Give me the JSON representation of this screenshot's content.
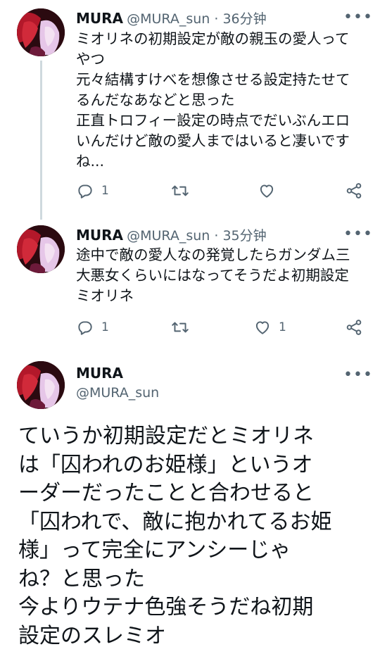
{
  "tweets": [
    {
      "name": "MURA",
      "handle": "@MURA_sun",
      "time": "36分钟",
      "text": "ミオリネの初期設定が敵の親玉の愛人って\nやつ\n元々結構すけべを想像させる設定持たせて\nるんだなあなどと思った\n正直トロフィー設定の時点でだいぶんエロ\nいんだけど敵の愛人まではいると凄いです\nね...",
      "replies": "1",
      "retweets": "",
      "likes": "",
      "more": "•••"
    },
    {
      "name": "MURA",
      "handle": "@MURA_sun",
      "time": "35分钟",
      "text": "途中で敵の愛人なの発覚したらガンダム三\n大悪女くらいにはなってそうだよ初期設定\nミオリネ",
      "replies": "1",
      "retweets": "",
      "likes": "1",
      "more": "•••"
    }
  ],
  "main_tweet": {
    "name": "MURA",
    "handle": "@MURA_sun",
    "more": "•••",
    "text": "ていうか初期設定だとミオリネ\nは「囚われのお姫様」というオ\nーダーだったことと合わせると\n「囚われで、敵に抱かれてるお姫\n様」って完全にアンシーじゃ\nね？と思った\n今よりウテナ色強そうだね初期\n設定のスレミオ"
  },
  "separator": " · ",
  "colors": {
    "text": "#0f1419",
    "secondary": "#536471",
    "thread_line": "#cfd9de"
  },
  "icons": [
    "reply-icon",
    "retweet-icon",
    "like-icon",
    "share-icon",
    "more-icon"
  ]
}
